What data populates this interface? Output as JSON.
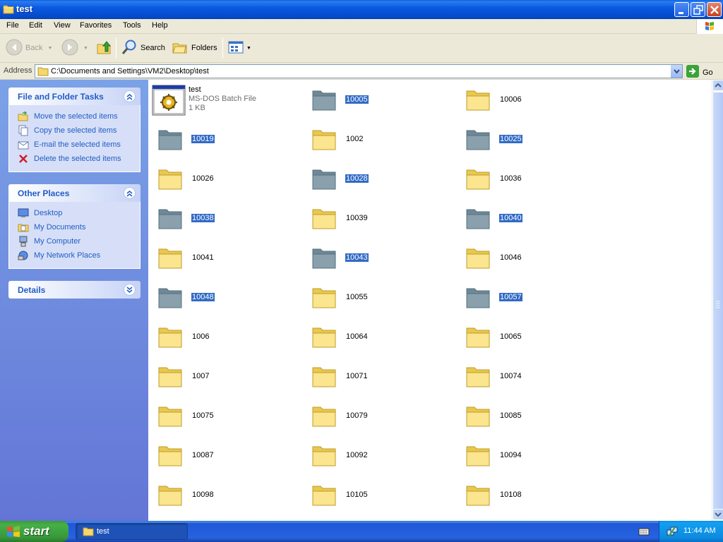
{
  "window": {
    "title": "test"
  },
  "menu": [
    "File",
    "Edit",
    "View",
    "Favorites",
    "Tools",
    "Help"
  ],
  "toolbar": {
    "back": "Back",
    "search": "Search",
    "folders": "Folders"
  },
  "address": {
    "label": "Address",
    "path": "C:\\Documents and Settings\\VM2\\Desktop\\test",
    "go": "Go"
  },
  "tasks": {
    "file_folder": {
      "title": "File and Folder Tasks",
      "items": [
        "Move the selected items",
        "Copy the selected items",
        "E-mail the selected items",
        "Delete the selected items"
      ]
    },
    "other_places": {
      "title": "Other Places",
      "items": [
        "Desktop",
        "My Documents",
        "My Computer",
        "My Network Places"
      ]
    },
    "details": {
      "title": "Details"
    }
  },
  "batch_file": {
    "name": "test",
    "type": "MS-DOS Batch File",
    "size": "1 KB"
  },
  "folders": [
    {
      "name": "10005",
      "selected": true
    },
    {
      "name": "10006",
      "selected": false
    },
    {
      "name": "10019",
      "selected": true
    },
    {
      "name": "1002",
      "selected": false
    },
    {
      "name": "10025",
      "selected": true
    },
    {
      "name": "10026",
      "selected": false
    },
    {
      "name": "10028",
      "selected": true
    },
    {
      "name": "10036",
      "selected": false
    },
    {
      "name": "10038",
      "selected": true
    },
    {
      "name": "10039",
      "selected": false
    },
    {
      "name": "10040",
      "selected": true
    },
    {
      "name": "10041",
      "selected": false
    },
    {
      "name": "10043",
      "selected": true
    },
    {
      "name": "10046",
      "selected": false
    },
    {
      "name": "10048",
      "selected": true
    },
    {
      "name": "10055",
      "selected": false
    },
    {
      "name": "10057",
      "selected": true
    },
    {
      "name": "1006",
      "selected": false
    },
    {
      "name": "10064",
      "selected": false
    },
    {
      "name": "10065",
      "selected": false
    },
    {
      "name": "1007",
      "selected": false
    },
    {
      "name": "10071",
      "selected": false
    },
    {
      "name": "10074",
      "selected": false
    },
    {
      "name": "10075",
      "selected": false
    },
    {
      "name": "10079",
      "selected": false
    },
    {
      "name": "10085",
      "selected": false
    },
    {
      "name": "10087",
      "selected": false
    },
    {
      "name": "10092",
      "selected": false
    },
    {
      "name": "10094",
      "selected": false
    },
    {
      "name": "10098",
      "selected": false
    },
    {
      "name": "10105",
      "selected": false
    },
    {
      "name": "10108",
      "selected": false
    }
  ],
  "taskbar": {
    "start": "start",
    "task": "test",
    "clock": "11:44 AM"
  },
  "colors": {
    "titlebar": "#0a5ae0",
    "selection": "#316ac5",
    "link": "#215dc6",
    "taskpane": "#7ba2e7"
  }
}
